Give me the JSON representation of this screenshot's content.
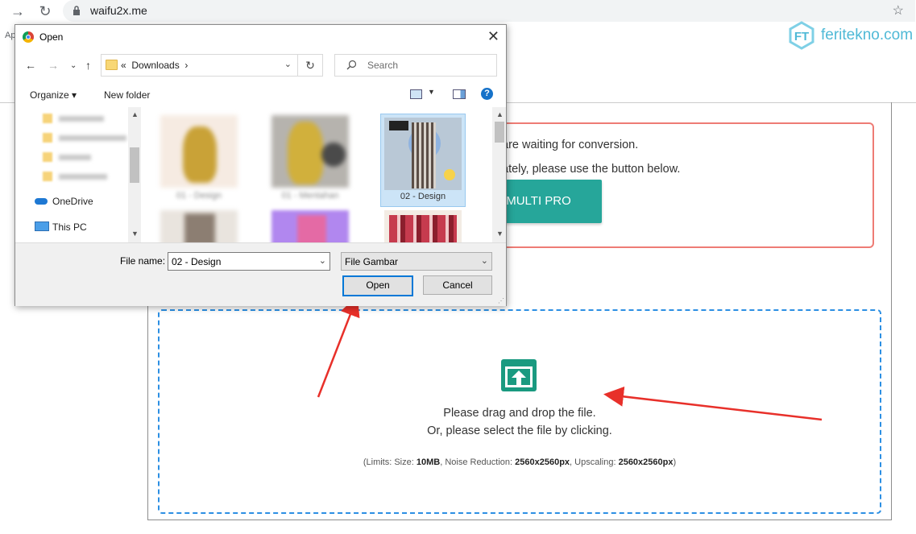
{
  "browser": {
    "url": "waifu2x.me",
    "bookmark_apps": "Ap"
  },
  "watermark": {
    "text": "feritekno.com",
    "color": "#4fb9d6"
  },
  "page": {
    "notice_line1": "are waiting for conversion.",
    "notice_line2": "ately, please use the button below.",
    "pro_button": "X-MULTI PRO",
    "drop_line1": "Please drag and drop the file.",
    "drop_line2": "Or, please select the file by clicking.",
    "limits": {
      "prefix": "(Limits: Size: ",
      "size": "10MB",
      "noise_label": ", Noise Reduction: ",
      "noise": "2560x2560px",
      "upscale_label": ", Upscaling: ",
      "upscale": "2560x2560px",
      "suffix": ")"
    },
    "accent": "#26a69a",
    "notice_border": "#ee7c75",
    "dropzone_border": "#2c8fe3"
  },
  "dialog": {
    "title": "Open",
    "path_prefix": "«",
    "path_folder": "Downloads",
    "search_placeholder": "Search",
    "organize": "Organize ▾",
    "new_folder": "New folder",
    "nav": {
      "onedrive": "OneDrive",
      "this_pc": "This PC"
    },
    "files": [
      {
        "caption": ""
      },
      {
        "caption": ""
      },
      {
        "caption": "02 - Design",
        "selected": true
      },
      {
        "caption": ""
      },
      {
        "caption": ""
      },
      {
        "caption": ""
      }
    ],
    "file_name_label": "File name:",
    "file_name_value": "02 - Design",
    "file_type_value": "File Gambar",
    "open_button": "Open",
    "cancel_button": "Cancel"
  }
}
